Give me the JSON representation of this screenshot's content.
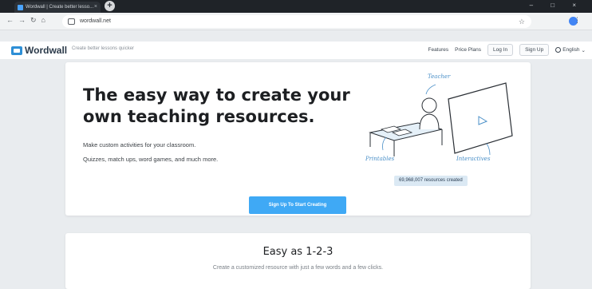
{
  "browser": {
    "tab_title": "Wordwall | Create better lesso...",
    "tab_close": "×",
    "newtab_label": "+",
    "url": "wordwall.net",
    "window_controls": "–  □  ×"
  },
  "header": {
    "logo_text": "Wordwall",
    "tagline": "Create better lessons quicker",
    "nav": [
      "Features",
      "Price Plans"
    ],
    "login_label": "Log In",
    "signup_label": "Sign Up",
    "language": "English"
  },
  "hero": {
    "title": "The easy way to create your own teaching resources.",
    "line1": "Make custom activities for your classroom.",
    "line2": "Quizzes, match ups, word games, and much more.",
    "labels": {
      "teacher": "Teacher",
      "printables": "Printables",
      "interactives": "Interactives"
    },
    "counter": "69,968,007 resources created",
    "cta_label": "Sign Up To Start Creating"
  },
  "easy": {
    "title": "Easy as 1-2-3",
    "subtitle": "Create a customized resource with just a few words and a few clicks."
  },
  "colors": {
    "accent": "#3fa9f5",
    "brand": "#2e8fd6",
    "counter_bg": "#dbe9f4"
  }
}
